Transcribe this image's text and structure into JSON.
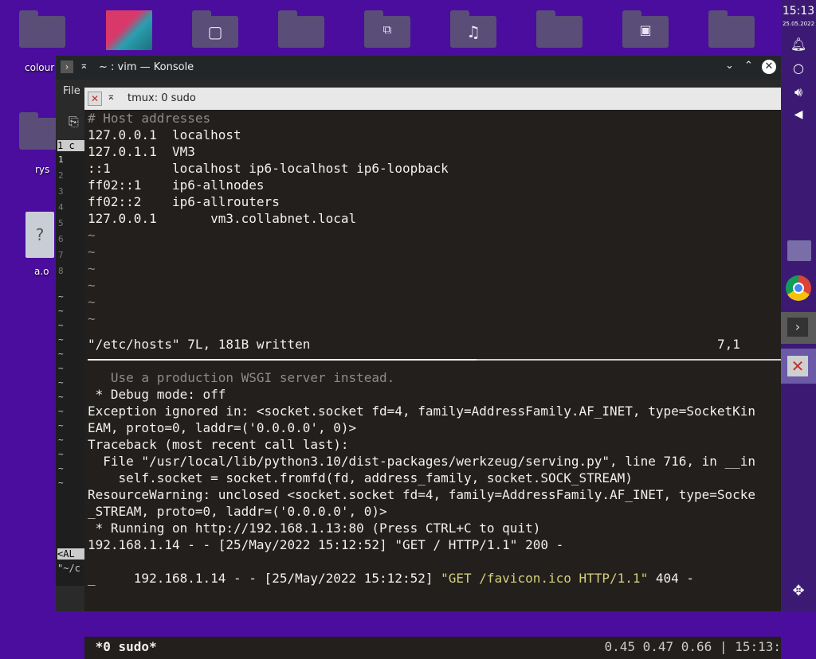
{
  "desktop": {
    "labels": {
      "colour": "colour",
      "rys": "rys",
      "ao": "a.o"
    },
    "icons": [
      "folder-icon",
      "image-thumbnail-icon",
      "folder-icon",
      "folder-icon",
      "folder-icon",
      "folder-icon",
      "folder-icon",
      "folder-icon",
      "folder-icon"
    ]
  },
  "panel": {
    "time": "15:13",
    "date": "25.05.2022",
    "icons": [
      "bell-icon",
      "bulb-icon",
      "speaker-icon",
      "arrow-left-icon",
      "folder-icon",
      "chrome-icon",
      "konsole-icon",
      "close-icon"
    ]
  },
  "konsole": {
    "title": "~ : vim — Konsole",
    "menu_file": "File",
    "tmux_title": "tmux: 0 sudo",
    "vim_lines": [
      "# Host addresses",
      "127.0.0.1  localhost",
      "127.0.1.1  VM3",
      "::1        localhost ip6-localhost ip6-loopback",
      "ff02::1    ip6-allnodes",
      "ff02::2    ip6-allrouters",
      "127.0.0.1       vm3.collabnet.local"
    ],
    "vim_message": "\"/etc/hosts\" 7L, 181B written",
    "vim_position": "7,1",
    "server_lines": [
      "   Use a production WSGI server instead.",
      " * Debug mode: off",
      "Exception ignored in: <socket.socket fd=4, family=AddressFamily.AF_INET, type=SocketKin",
      "EAM, proto=0, laddr=('0.0.0.0', 0)>",
      "Traceback (most recent call last):",
      "  File \"/usr/local/lib/python3.10/dist-packages/werkzeug/serving.py\", line 716, in __in",
      "    self.socket = socket.fromfd(fd, address_family, socket.SOCK_STREAM)",
      "ResourceWarning: unclosed <socket.socket fd=4, family=AddressFamily.AF_INET, type=Socke",
      "_STREAM, proto=0, laddr=('0.0.0.0', 0)>",
      " * Running on http://192.168.1.13:80 (Press CTRL+C to quit)",
      "192.168.1.14 - - [25/May/2022 15:12:52] \"GET / HTTP/1.1\" 200 -"
    ],
    "last_line_prefix": "192.168.1.14 - - [25/May/2022 15:12:52] ",
    "last_line_request": "\"GET /favicon.ico HTTP/1.1\"",
    "last_line_suffix": " 404 -",
    "cursor": "_",
    "status_left": " *0 sudo*",
    "status_right": "0.45 0.47 0.66 | 15:13:",
    "inner_vim": {
      "tab": "1 c",
      "line_numbers": [
        "1",
        "2",
        "3",
        "4",
        "5",
        "6",
        "7",
        "8"
      ],
      "mode": "<AL",
      "file": "\"~/c"
    }
  },
  "colors": {
    "desktop_bg": "#4a0d9e",
    "terminal_bg": "#221f1c",
    "accent_yellow": "#d4d07a"
  }
}
